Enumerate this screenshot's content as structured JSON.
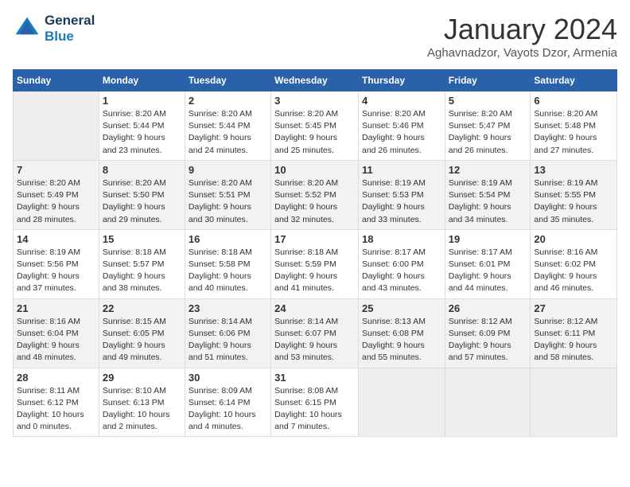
{
  "header": {
    "logo_line1": "General",
    "logo_line2": "Blue",
    "month": "January 2024",
    "location": "Aghavnadzor, Vayots Dzor, Armenia"
  },
  "weekdays": [
    "Sunday",
    "Monday",
    "Tuesday",
    "Wednesday",
    "Thursday",
    "Friday",
    "Saturday"
  ],
  "weeks": [
    [
      {
        "day": "",
        "info": ""
      },
      {
        "day": "1",
        "info": "Sunrise: 8:20 AM\nSunset: 5:44 PM\nDaylight: 9 hours\nand 23 minutes."
      },
      {
        "day": "2",
        "info": "Sunrise: 8:20 AM\nSunset: 5:44 PM\nDaylight: 9 hours\nand 24 minutes."
      },
      {
        "day": "3",
        "info": "Sunrise: 8:20 AM\nSunset: 5:45 PM\nDaylight: 9 hours\nand 25 minutes."
      },
      {
        "day": "4",
        "info": "Sunrise: 8:20 AM\nSunset: 5:46 PM\nDaylight: 9 hours\nand 26 minutes."
      },
      {
        "day": "5",
        "info": "Sunrise: 8:20 AM\nSunset: 5:47 PM\nDaylight: 9 hours\nand 26 minutes."
      },
      {
        "day": "6",
        "info": "Sunrise: 8:20 AM\nSunset: 5:48 PM\nDaylight: 9 hours\nand 27 minutes."
      }
    ],
    [
      {
        "day": "7",
        "info": "Sunrise: 8:20 AM\nSunset: 5:49 PM\nDaylight: 9 hours\nand 28 minutes."
      },
      {
        "day": "8",
        "info": "Sunrise: 8:20 AM\nSunset: 5:50 PM\nDaylight: 9 hours\nand 29 minutes."
      },
      {
        "day": "9",
        "info": "Sunrise: 8:20 AM\nSunset: 5:51 PM\nDaylight: 9 hours\nand 30 minutes."
      },
      {
        "day": "10",
        "info": "Sunrise: 8:20 AM\nSunset: 5:52 PM\nDaylight: 9 hours\nand 32 minutes."
      },
      {
        "day": "11",
        "info": "Sunrise: 8:19 AM\nSunset: 5:53 PM\nDaylight: 9 hours\nand 33 minutes."
      },
      {
        "day": "12",
        "info": "Sunrise: 8:19 AM\nSunset: 5:54 PM\nDaylight: 9 hours\nand 34 minutes."
      },
      {
        "day": "13",
        "info": "Sunrise: 8:19 AM\nSunset: 5:55 PM\nDaylight: 9 hours\nand 35 minutes."
      }
    ],
    [
      {
        "day": "14",
        "info": "Sunrise: 8:19 AM\nSunset: 5:56 PM\nDaylight: 9 hours\nand 37 minutes."
      },
      {
        "day": "15",
        "info": "Sunrise: 8:18 AM\nSunset: 5:57 PM\nDaylight: 9 hours\nand 38 minutes."
      },
      {
        "day": "16",
        "info": "Sunrise: 8:18 AM\nSunset: 5:58 PM\nDaylight: 9 hours\nand 40 minutes."
      },
      {
        "day": "17",
        "info": "Sunrise: 8:18 AM\nSunset: 5:59 PM\nDaylight: 9 hours\nand 41 minutes."
      },
      {
        "day": "18",
        "info": "Sunrise: 8:17 AM\nSunset: 6:00 PM\nDaylight: 9 hours\nand 43 minutes."
      },
      {
        "day": "19",
        "info": "Sunrise: 8:17 AM\nSunset: 6:01 PM\nDaylight: 9 hours\nand 44 minutes."
      },
      {
        "day": "20",
        "info": "Sunrise: 8:16 AM\nSunset: 6:02 PM\nDaylight: 9 hours\nand 46 minutes."
      }
    ],
    [
      {
        "day": "21",
        "info": "Sunrise: 8:16 AM\nSunset: 6:04 PM\nDaylight: 9 hours\nand 48 minutes."
      },
      {
        "day": "22",
        "info": "Sunrise: 8:15 AM\nSunset: 6:05 PM\nDaylight: 9 hours\nand 49 minutes."
      },
      {
        "day": "23",
        "info": "Sunrise: 8:14 AM\nSunset: 6:06 PM\nDaylight: 9 hours\nand 51 minutes."
      },
      {
        "day": "24",
        "info": "Sunrise: 8:14 AM\nSunset: 6:07 PM\nDaylight: 9 hours\nand 53 minutes."
      },
      {
        "day": "25",
        "info": "Sunrise: 8:13 AM\nSunset: 6:08 PM\nDaylight: 9 hours\nand 55 minutes."
      },
      {
        "day": "26",
        "info": "Sunrise: 8:12 AM\nSunset: 6:09 PM\nDaylight: 9 hours\nand 57 minutes."
      },
      {
        "day": "27",
        "info": "Sunrise: 8:12 AM\nSunset: 6:11 PM\nDaylight: 9 hours\nand 58 minutes."
      }
    ],
    [
      {
        "day": "28",
        "info": "Sunrise: 8:11 AM\nSunset: 6:12 PM\nDaylight: 10 hours\nand 0 minutes."
      },
      {
        "day": "29",
        "info": "Sunrise: 8:10 AM\nSunset: 6:13 PM\nDaylight: 10 hours\nand 2 minutes."
      },
      {
        "day": "30",
        "info": "Sunrise: 8:09 AM\nSunset: 6:14 PM\nDaylight: 10 hours\nand 4 minutes."
      },
      {
        "day": "31",
        "info": "Sunrise: 8:08 AM\nSunset: 6:15 PM\nDaylight: 10 hours\nand 7 minutes."
      },
      {
        "day": "",
        "info": ""
      },
      {
        "day": "",
        "info": ""
      },
      {
        "day": "",
        "info": ""
      }
    ]
  ]
}
